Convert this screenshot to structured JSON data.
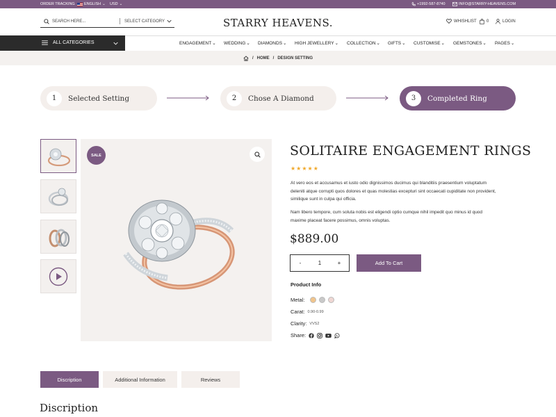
{
  "topbar": {
    "order_tracking": "ORDER TRACKING",
    "language": "ENGLISH",
    "currency": "USD",
    "phone": "+1992-587-8740",
    "email": "INFO@STARRY-HEAVENS.COM"
  },
  "header": {
    "search_placeholder": "SEARCH HERE...",
    "category_select": "SELECT CATEGORY",
    "logo": "STARRY HEAVENS.",
    "wishlist": "WHISHLIST",
    "cart_count": "0",
    "login": "LOGIN"
  },
  "nav": {
    "all_categories": "ALL CATEGORIES",
    "items": [
      "ENGAGEMENT",
      "WEDDING",
      "DIAMONDS",
      "HIGH JEWELLERY",
      "COLLECTION",
      "GIFTS",
      "CUSTOMISE",
      "GEMSTONES",
      "PAGES"
    ]
  },
  "breadcrumb": {
    "home": "HOME",
    "separator": "/",
    "current": "DESIGN SETTING"
  },
  "steps": [
    {
      "num": "1",
      "label": "Selected Setting"
    },
    {
      "num": "2",
      "label": "Chose A Diamond"
    },
    {
      "num": "3",
      "label": "Completed Ring"
    }
  ],
  "gallery": {
    "sale_badge": "SALE"
  },
  "product": {
    "title": "SOLITAIRE ENGAGEMENT RINGS",
    "rating": 5,
    "stars": "★★★★★",
    "desc1": "At vero eos et accusamus et iusto odio dignissimos ducimus qui blanditiis praesentium voluptatum deleniti atque corrupti quos dolores et quas molestias excepturi sint occaecati cupiditate non provident, similique sunt in culpa qui officia.",
    "desc2": "Nam libero tempore, cum soluta nobis est eligendi optio cumque nihil impedit quo minus id quod maxime placeat facere possimus, omnis voluptas.",
    "price": "$889.00",
    "qty_minus": "-",
    "qty_value": "1",
    "qty_plus": "+",
    "add_to_cart": "Add To Cart",
    "info_heading": "Product Info",
    "metal_label": "Metal:",
    "metal_colors": [
      "#f1c58c",
      "#c9c9c9",
      "#efd7d3"
    ],
    "carat_label": "Carat:",
    "carat_value": "0.90-0.99",
    "clarity_label": "Clarity:",
    "clarity_value": "VVS2",
    "share_label": "Share:"
  },
  "tabs": [
    "Discription",
    "Additional Information",
    "Reviews"
  ],
  "section_heading": "Discription",
  "colors": {
    "accent": "#7b5a82",
    "dark": "#2b2b2b",
    "light_bg": "#f4f1ef"
  }
}
